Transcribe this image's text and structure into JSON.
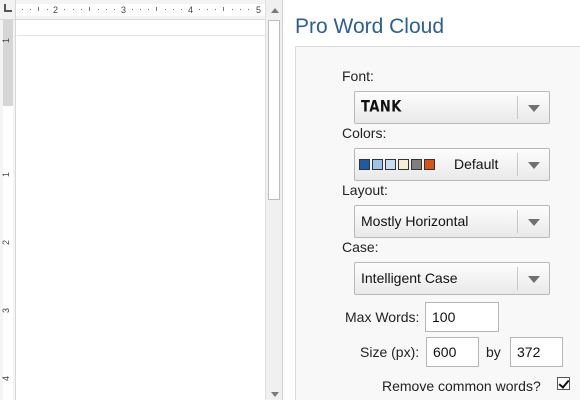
{
  "ruler": {
    "h_numbers": [
      "2",
      "3",
      "4",
      "5"
    ],
    "v_numbers": [
      "1",
      "1",
      "2",
      "3",
      "4"
    ]
  },
  "pane": {
    "title": "Pro Word Cloud",
    "font": {
      "label": "Font:",
      "value": "TANK"
    },
    "colors": {
      "label": "Colors:",
      "value": "Default",
      "swatches": [
        "#1f5aa6",
        "#9fc3e6",
        "#c9ddf0",
        "#f4edd7",
        "#7f7f7f",
        "#d4541e"
      ]
    },
    "layout": {
      "label": "Layout:",
      "value": "Mostly Horizontal"
    },
    "case": {
      "label": "Case:",
      "value": "Intelligent Case"
    },
    "max_words": {
      "label": "Max Words:",
      "value": "100"
    },
    "size": {
      "label": "Size (px):",
      "width": "600",
      "by_label": "by",
      "height": "372"
    },
    "remove_common": {
      "label": "Remove common words?",
      "checked": true
    }
  },
  "colors": {
    "title": "#2e5f94"
  }
}
